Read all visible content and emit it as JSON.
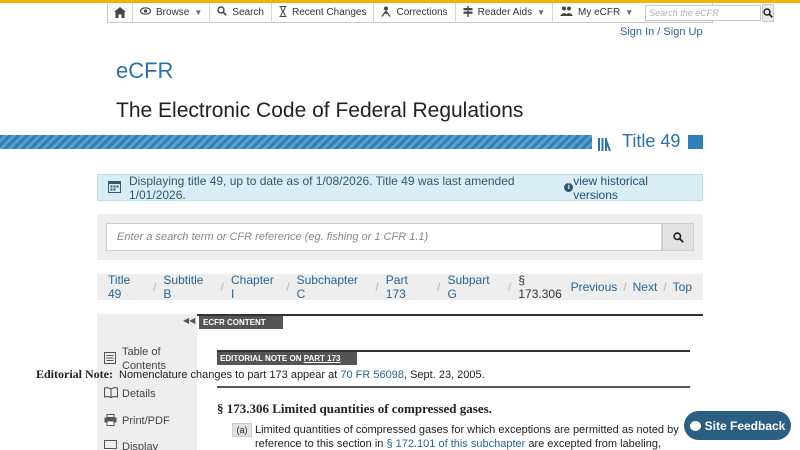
{
  "topnav": {
    "items": [
      {
        "label": "Browse",
        "icon": "eye-icon",
        "dropdown": true
      },
      {
        "label": "Search",
        "icon": "magnifier-icon",
        "dropdown": false
      },
      {
        "label": "Recent Changes",
        "icon": "hourglass-icon",
        "dropdown": false
      },
      {
        "label": "Corrections",
        "icon": "user-strike-icon",
        "dropdown": false
      },
      {
        "label": "Reader Aids",
        "icon": "signpost-icon",
        "dropdown": true
      },
      {
        "label": "My eCFR",
        "icon": "users-icon",
        "dropdown": true
      }
    ],
    "search_placeholder": "Search the eCFR"
  },
  "auth": {
    "sign_in": "Sign In",
    "divider": " / ",
    "sign_up": "Sign Up"
  },
  "brand": "eCFR",
  "site_title": "The Electronic Code of Federal Regulations",
  "title_label": "Title 49",
  "info": {
    "text": "Displaying title 49, up to date as of 1/08/2026. Title 49 was last amended 1/01/2026.",
    "link": "view historical versions"
  },
  "main_search": {
    "placeholder": "Enter a search term or CFR reference (eg. fishing or 1 CFR 1.1)"
  },
  "breadcrumb": {
    "items": [
      "Title 49",
      "Subtitle B",
      "Chapter I",
      "Subchapter C",
      "Part 173",
      "Subpart G"
    ],
    "current": "§ 173.306",
    "pager": [
      "Previous",
      "Next",
      "Top"
    ]
  },
  "sidebar": {
    "items": [
      {
        "label": "Table of Contents",
        "icon": "list-icon"
      },
      {
        "label": "Details",
        "icon": "book-icon"
      },
      {
        "label": "Print/PDF",
        "icon": "printer-icon"
      },
      {
        "label": "Display",
        "icon": "display-icon"
      }
    ]
  },
  "content": {
    "tab": "ECFR CONTENT",
    "editorial_tab_prefix": "EDITORIAL NOTE ON ",
    "editorial_tab_link": "PART 173",
    "editorial_label": "Editorial Note:",
    "editorial_text": "Nomenclature changes to part 173 appear at ",
    "editorial_link": "70 FR 56098",
    "editorial_suffix": ", Sept. 23, 2005.",
    "section_title": "§ 173.306 Limited quantities of compressed gases.",
    "para_label": "(a)",
    "para_text_1": "Limited quantities of compressed gases for which exceptions are permitted as noted by reference to this section in ",
    "para_link": "§ 172.101 of this subchapter",
    "para_text_2": " are excepted from labeling, except when offered"
  },
  "feedback": {
    "label": "Site Feedback"
  }
}
